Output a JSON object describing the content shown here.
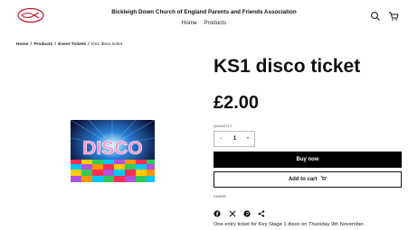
{
  "header": {
    "site_title": "Bickleigh Down Church of England Parents and Friends Association",
    "nav": [
      "Home",
      "Products"
    ],
    "icons": [
      "search-icon",
      "cart-icon"
    ]
  },
  "breadcrumb": {
    "items": [
      "Home",
      "Products",
      "Event Tickets"
    ],
    "separator": "/",
    "current": "KS1 disco ticket"
  },
  "product": {
    "image_text": "DISCO",
    "title": "KS1 disco ticket",
    "price": "£2.00",
    "quantity_label": "QUANTITY",
    "quantity_value": "1",
    "minus": "−",
    "plus": "+",
    "buy_now_label": "Buy now",
    "add_to_cart_label": "Add to cart",
    "share_label": "SHARE",
    "share_icons": [
      "facebook-icon",
      "x-icon",
      "pinterest-icon",
      "share-icon"
    ],
    "description": "One entry ticket for Key Stage 1 disco on Thursday 9th November."
  },
  "colors": {
    "primary_button": "#000000",
    "logo_red": "#c8102e"
  }
}
